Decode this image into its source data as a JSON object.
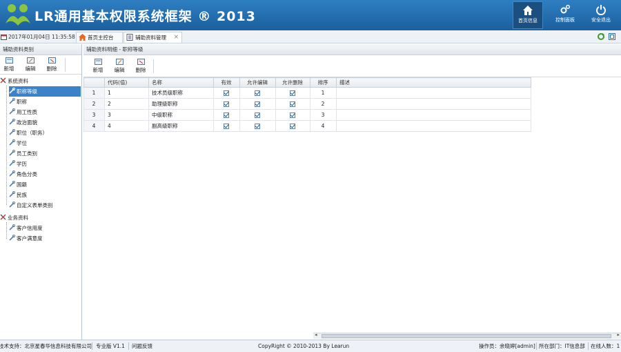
{
  "header": {
    "title": "LR通用基本权限系统框架 ® 2013",
    "buttons": [
      {
        "label": "首页信息",
        "icon": "home-icon"
      },
      {
        "label": "控制面板",
        "icon": "gears-icon"
      },
      {
        "label": "安全退出",
        "icon": "power-icon"
      }
    ],
    "accent": "#1b5f9e"
  },
  "tabs": {
    "datetime": "2017年01月04日 11:35:58",
    "items": [
      {
        "label": "首页主控台"
      },
      {
        "label": "辅助资料管理",
        "close": "×"
      }
    ]
  },
  "left": {
    "title": "辅助资料类别",
    "toolbar": {
      "add": "新增",
      "edit": "编辑",
      "delete": "删除"
    },
    "groups": [
      {
        "label": "系统资料",
        "items": [
          "职称等级",
          "职称",
          "用工性质",
          "政治面貌",
          "职位（职务）",
          "学位",
          "员工类别",
          "学历",
          "角色分类",
          "国籍",
          "民族",
          "自定义表单类别"
        ]
      },
      {
        "label": "业务资料",
        "items": [
          "客户信用度",
          "客户满意度"
        ]
      }
    ],
    "selected_item": "职称等级"
  },
  "main": {
    "breadcrumb": "辅助资料明细 - 职称等级",
    "toolbar": {
      "add": "新增",
      "edit": "编辑",
      "delete": "删除"
    },
    "columns": [
      "",
      "代码(值)",
      "名称",
      "有效",
      "允许编辑",
      "允许删除",
      "排序",
      "描述"
    ],
    "rows": [
      {
        "rn": "1",
        "code": "1",
        "name": "技术员级职称",
        "valid": true,
        "editable": true,
        "deletable": true,
        "sort": "1",
        "desc": ""
      },
      {
        "rn": "2",
        "code": "2",
        "name": "助理级职称",
        "valid": true,
        "editable": true,
        "deletable": true,
        "sort": "2",
        "desc": ""
      },
      {
        "rn": "3",
        "code": "3",
        "name": "中级职称",
        "valid": true,
        "editable": true,
        "deletable": true,
        "sort": "3",
        "desc": ""
      },
      {
        "rn": "4",
        "code": "4",
        "name": "副高级职称",
        "valid": true,
        "editable": true,
        "deletable": true,
        "sort": "4",
        "desc": ""
      }
    ]
  },
  "footer": {
    "support": "技术支持：北京星春华信息科技有限公司",
    "edition": "专业版 V1.1",
    "feedback": "问题反馈",
    "copyright": "CopyRight © 2010-2013 By Learun",
    "operator": "操作员：余晓婷[admin]",
    "dept": "所在部门：IT信息部",
    "online": "在线人数：1"
  }
}
